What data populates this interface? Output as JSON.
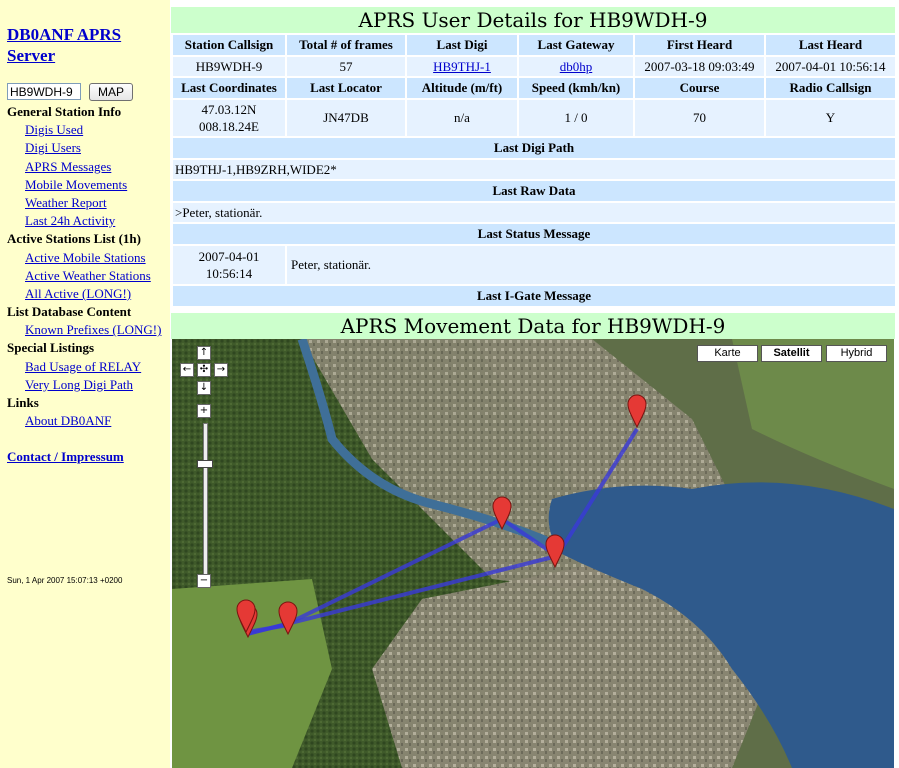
{
  "sidebar": {
    "site_title": "DB0ANF APRS Server",
    "callsign_input": "HB9WDH-9",
    "map_button": "MAP",
    "sections": [
      {
        "heading": "General Station Info",
        "items": [
          "Digis Used",
          "Digi Users",
          "APRS Messages",
          "Mobile Movements",
          "Weather Report",
          "Last 24h Activity"
        ]
      },
      {
        "heading": "Active Stations List (1h)",
        "items": [
          "Active Mobile Stations",
          "Active Weather Stations",
          "All Active (LONG!)"
        ]
      },
      {
        "heading": "List Database Content",
        "items": [
          "Known Prefixes (LONG!)"
        ]
      },
      {
        "heading": "Special Listings",
        "items": [
          "Bad Usage of RELAY",
          "Very Long Digi Path"
        ]
      },
      {
        "heading": "Links",
        "items": [
          "About DB0ANF"
        ]
      }
    ],
    "contact": "Contact / Impressum",
    "timestamp": "Sun, 1 Apr 2007 15:07:13 +0200"
  },
  "details": {
    "title": "APRS User Details for HB9WDH-9",
    "row1_headers": [
      "Station Callsign",
      "Total # of frames",
      "Last Digi",
      "Last Gateway",
      "First Heard",
      "Last Heard"
    ],
    "row1_values": [
      "HB9WDH-9",
      "57",
      "HB9THJ-1",
      "db0hp",
      "2007-03-18 09:03:49",
      "2007-04-01 10:56:14"
    ],
    "row2_headers": [
      "Last Coordinates",
      "Last Locator",
      "Altitude (m/ft)",
      "Speed (kmh/kn)",
      "Course",
      "Radio Callsign"
    ],
    "row2_values": [
      "47.03.12N 008.18.24E",
      "JN47DB",
      "n/a",
      "1 / 0",
      "70",
      "Y"
    ],
    "coord_lat": "47.03.12N",
    "coord_lon": "008.18.24E",
    "digi_path_heading": "Last Digi Path",
    "digi_path": "HB9THJ-1,HB9ZRH,WIDE2*",
    "raw_data_heading": "Last Raw Data",
    "raw_data": ">Peter, stationär.",
    "status_heading": "Last Status Message",
    "status_date": "2007-04-01",
    "status_time": "10:56:14",
    "status_text": "Peter, stationär.",
    "igate_heading": "Last I-Gate Message"
  },
  "movement": {
    "title": "APRS Movement Data for HB9WDH-9",
    "map_types": [
      "Karte",
      "Satellit",
      "Hybrid"
    ],
    "active_map_type": "Satellit",
    "markers": 6
  }
}
